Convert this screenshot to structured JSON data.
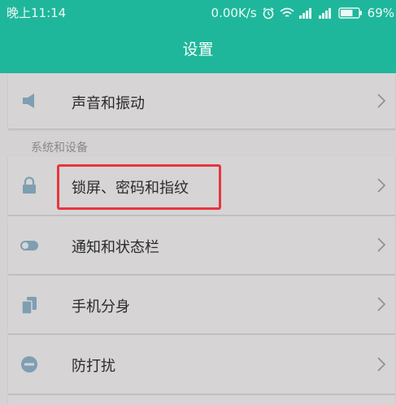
{
  "status_bar": {
    "time": "晚上11:14",
    "network_speed": "0.00K/s",
    "battery_percent": "69%",
    "icons": [
      "alarm-icon",
      "wifi-icon",
      "signal-icon",
      "signal-icon",
      "battery-icon"
    ],
    "battery_level": 0.69
  },
  "app_bar": {
    "title": "设置"
  },
  "items_top": [
    {
      "label": "声音和振动",
      "icon": "speaker-icon"
    }
  ],
  "section": {
    "header": "系统和设备",
    "items": [
      {
        "label": "锁屏、密码和指纹",
        "icon": "lock-icon",
        "highlighted": true
      },
      {
        "label": "通知和状态栏",
        "icon": "toggle-icon"
      },
      {
        "label": "手机分身",
        "icon": "dual-phone-icon"
      },
      {
        "label": "防打扰",
        "icon": "do-not-disturb-icon"
      }
    ]
  },
  "colors": {
    "accent": "#1fb79b",
    "icon": "#7e9eb2",
    "highlight_border": "#e8363d",
    "background": "#d4d2d3"
  }
}
